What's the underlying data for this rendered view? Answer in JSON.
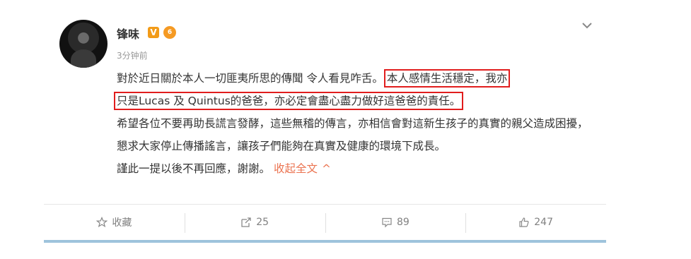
{
  "post": {
    "author": "锋味",
    "verified_badge": "V",
    "medal_label": "6",
    "time": "3分钟前",
    "paragraph1_part1": "對於近日關於本人一切匪夷所思的傳聞 令人看見咋舌。",
    "paragraph1_highlight_a": "本人感情生活穩定，我亦",
    "paragraph1_highlight_b": "只是Lucas 及 Quintus的爸爸，亦必定會盡心盡力做好這爸爸的責任。",
    "paragraph2": "希望各位不要再助長謊言發酵，這些無稽的傳言，亦相信會對這新生孩子的真實的親父造成困擾，懇求大家停止傳播謠言，讓孩子們能夠在真實及健康的環境下成長。",
    "paragraph3": "謹此一提以後不再回應，謝謝。",
    "collapse_label": "收起全文",
    "collapse_icon": "^"
  },
  "actions": {
    "favorite_label": "收藏",
    "repost_count": "25",
    "comment_count": "89",
    "like_count": "247"
  },
  "colors": {
    "highlight_border": "#e11d1d",
    "link": "#eb7350",
    "bottom_bar": "#9ec3dc",
    "verified": "#f29b18"
  }
}
